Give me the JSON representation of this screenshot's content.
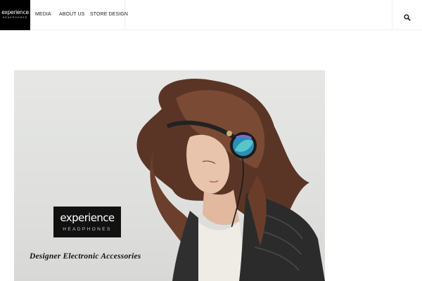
{
  "header": {
    "logo": {
      "wordmark": "experience",
      "subtitle": "HEADPHONES"
    },
    "nav": [
      {
        "label": "MEDIA"
      },
      {
        "label": "ABOUT US"
      },
      {
        "label": "STORE DESIGN"
      }
    ],
    "search": {
      "icon": "search-icon"
    }
  },
  "hero": {
    "badge": {
      "wordmark": "experience",
      "subtitle": "HEADPHONES"
    },
    "tagline": "Designer Electronic Accessories",
    "image": "woman-with-headphones-photo"
  }
}
